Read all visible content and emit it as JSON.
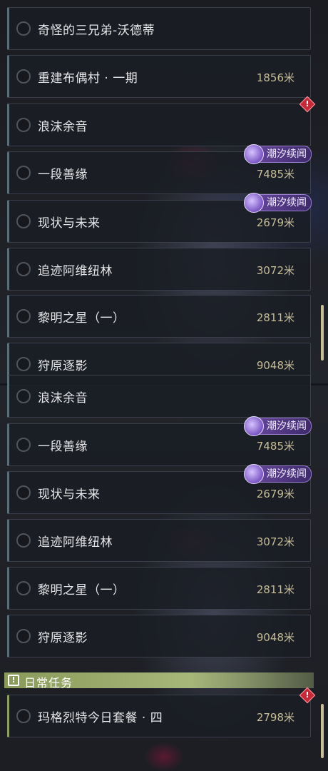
{
  "panels": [
    {
      "quests": [
        {
          "title": "奇怪的三兄弟-沃德蒂",
          "distance": "",
          "tag": "",
          "alert": false
        },
        {
          "title": "重建布偶村 · 一期",
          "distance": "1856米",
          "tag": "",
          "alert": false
        },
        {
          "title": "浪沫余音",
          "distance": "",
          "tag": "",
          "alert": true
        },
        {
          "title": "一段善缘",
          "distance": "7485米",
          "tag": "潮汐续闻",
          "alert": false
        },
        {
          "title": "现状与未来",
          "distance": "2679米",
          "tag": "潮汐续闻",
          "alert": false
        },
        {
          "title": "追迹阿维纽林",
          "distance": "3072米",
          "tag": "",
          "alert": false
        },
        {
          "title": "黎明之星（一）",
          "distance": "2811米",
          "tag": "",
          "alert": false
        },
        {
          "title": "狩原逐影",
          "distance": "9048米",
          "tag": "",
          "alert": false
        }
      ]
    },
    {
      "quests": [
        {
          "title": "浪沫余音",
          "distance": "",
          "tag": "",
          "alert": false
        },
        {
          "title": "一段善缘",
          "distance": "7485米",
          "tag": "潮汐续闻",
          "alert": false
        },
        {
          "title": "现状与未来",
          "distance": "2679米",
          "tag": "潮汐续闻",
          "alert": false
        },
        {
          "title": "追迹阿维纽林",
          "distance": "3072米",
          "tag": "",
          "alert": false
        },
        {
          "title": "黎明之星（一）",
          "distance": "2811米",
          "tag": "",
          "alert": false
        },
        {
          "title": "狩原逐影",
          "distance": "9048米",
          "tag": "",
          "alert": false
        }
      ],
      "section": {
        "title": "日常任务",
        "icon": "!",
        "quests": [
          {
            "title": "玛格烈特今日套餐 · 四",
            "distance": "2798米",
            "tag": "",
            "alert": true
          }
        ]
      }
    }
  ],
  "icons": {
    "radio": "radio-circle-icon",
    "tag": "tidal-swirl-icon",
    "alert": "alert-diamond-icon",
    "section": "exclamation-box-icon"
  },
  "colors": {
    "distance": "#c7bd96",
    "tag_bg": "#6c4aa3",
    "alert": "#c52a3a",
    "section_bg": "#8a9a5a"
  }
}
